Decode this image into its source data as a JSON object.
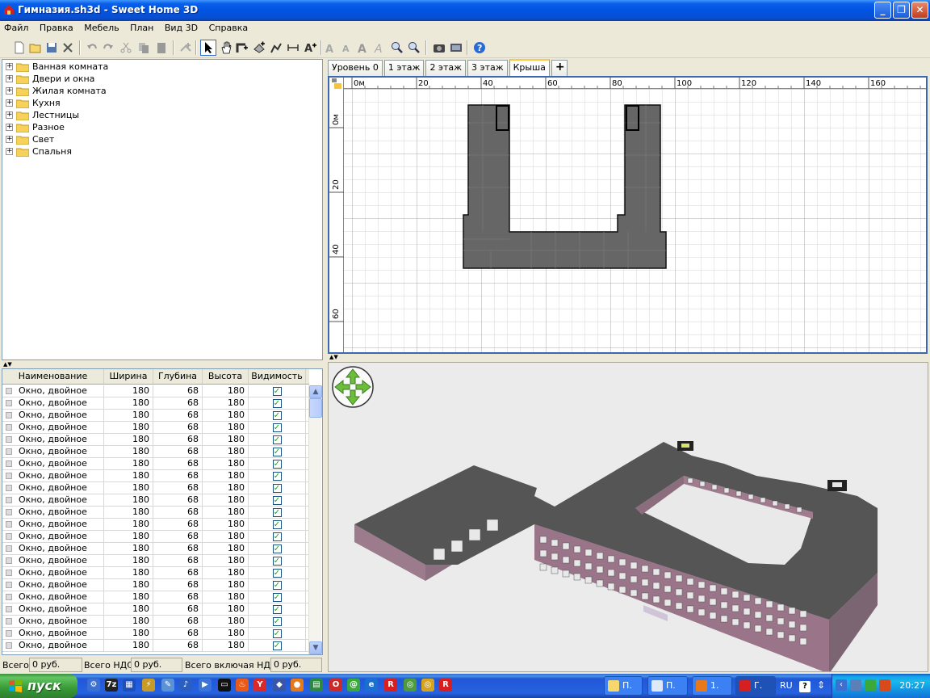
{
  "window": {
    "title": "Гимназия.sh3d - Sweet Home 3D"
  },
  "menu": [
    "Файл",
    "Правка",
    "Мебель",
    "План",
    "Вид 3D",
    "Справка"
  ],
  "toolbar": {
    "icons": [
      "new-file-icon",
      "open-file-icon",
      "save-file-icon",
      "preferences-icon",
      "undo-icon",
      "redo-icon",
      "cut-icon",
      "copy-icon",
      "paste-icon",
      "add-furniture-icon",
      "select-arrow-icon",
      "pan-hand-icon",
      "create-walls-icon",
      "create-rooms-icon",
      "create-polylines-icon",
      "create-dimensions-icon",
      "add-text-icon",
      "increase-text-icon",
      "decrease-text-icon",
      "bold-text-icon",
      "italic-text-icon",
      "zoom-in-icon",
      "zoom-out-icon",
      "create-photo-icon",
      "create-video-icon",
      "help-icon"
    ]
  },
  "catalog": {
    "categories": [
      "Ванная комната",
      "Двери и окна",
      "Жилая комната",
      "Кухня",
      "Лестницы",
      "Разное",
      "Свет",
      "Спальня"
    ]
  },
  "furniture_table": {
    "columns": [
      "Наименование",
      "Ширина",
      "Глубина",
      "Высота",
      "Видимость"
    ],
    "rows": [
      {
        "name": "Окно, двойное",
        "width": "180",
        "depth": "68",
        "height": "180",
        "visible": true
      },
      {
        "name": "Окно, двойное",
        "width": "180",
        "depth": "68",
        "height": "180",
        "visible": true
      },
      {
        "name": "Окно, двойное",
        "width": "180",
        "depth": "68",
        "height": "180",
        "visible": true
      },
      {
        "name": "Окно, двойное",
        "width": "180",
        "depth": "68",
        "height": "180",
        "visible": true
      },
      {
        "name": "Окно, двойное",
        "width": "180",
        "depth": "68",
        "height": "180",
        "visible": true
      },
      {
        "name": "Окно, двойное",
        "width": "180",
        "depth": "68",
        "height": "180",
        "visible": true
      },
      {
        "name": "Окно, двойное",
        "width": "180",
        "depth": "68",
        "height": "180",
        "visible": true
      },
      {
        "name": "Окно, двойное",
        "width": "180",
        "depth": "68",
        "height": "180",
        "visible": true
      },
      {
        "name": "Окно, двойное",
        "width": "180",
        "depth": "68",
        "height": "180",
        "visible": true
      },
      {
        "name": "Окно, двойное",
        "width": "180",
        "depth": "68",
        "height": "180",
        "visible": true
      },
      {
        "name": "Окно, двойное",
        "width": "180",
        "depth": "68",
        "height": "180",
        "visible": true
      },
      {
        "name": "Окно, двойное",
        "width": "180",
        "depth": "68",
        "height": "180",
        "visible": true
      },
      {
        "name": "Окно, двойное",
        "width": "180",
        "depth": "68",
        "height": "180",
        "visible": true
      },
      {
        "name": "Окно, двойное",
        "width": "180",
        "depth": "68",
        "height": "180",
        "visible": true
      },
      {
        "name": "Окно, двойное",
        "width": "180",
        "depth": "68",
        "height": "180",
        "visible": true
      },
      {
        "name": "Окно, двойное",
        "width": "180",
        "depth": "68",
        "height": "180",
        "visible": true
      },
      {
        "name": "Окно, двойное",
        "width": "180",
        "depth": "68",
        "height": "180",
        "visible": true
      },
      {
        "name": "Окно, двойное",
        "width": "180",
        "depth": "68",
        "height": "180",
        "visible": true
      },
      {
        "name": "Окно, двойное",
        "width": "180",
        "depth": "68",
        "height": "180",
        "visible": true
      },
      {
        "name": "Окно, двойное",
        "width": "180",
        "depth": "68",
        "height": "180",
        "visible": true
      },
      {
        "name": "Окно, двойное",
        "width": "180",
        "depth": "68",
        "height": "180",
        "visible": true
      },
      {
        "name": "Окно, двойное",
        "width": "180",
        "depth": "68",
        "height": "180",
        "visible": true
      }
    ]
  },
  "status": {
    "total_label": "Всего:",
    "total_value": "0 руб.",
    "vat_label": "Всего НДС:",
    "vat_value": "0 руб.",
    "total_incl_label": "Всего включая НДС:",
    "total_incl_value": "0 руб."
  },
  "levels": [
    "Уровень 0",
    "1 этаж",
    "2 этаж",
    "3 этаж",
    "Крыша"
  ],
  "active_level": "Крыша",
  "add_level_label": "+",
  "plan": {
    "ruler_x": [
      "0м",
      "20",
      "40",
      "60",
      "80",
      "100",
      "120",
      "140",
      "160"
    ],
    "ruler_y": [
      "0м",
      "20",
      "40",
      "60"
    ]
  },
  "taskbar": {
    "start_label": "пуск",
    "tasks": [
      {
        "label": "П.",
        "icon": "folder-icon"
      },
      {
        "label": "П.",
        "icon": "word-icon"
      },
      {
        "label": "1.",
        "icon": "firefox-icon"
      },
      {
        "label": "Г.",
        "icon": "sweethome-icon"
      }
    ],
    "lang": "RU",
    "clock": "20:27"
  },
  "colors": {
    "accent": "#0054e3",
    "roof": "#555555",
    "wall": "#a47f8f"
  }
}
